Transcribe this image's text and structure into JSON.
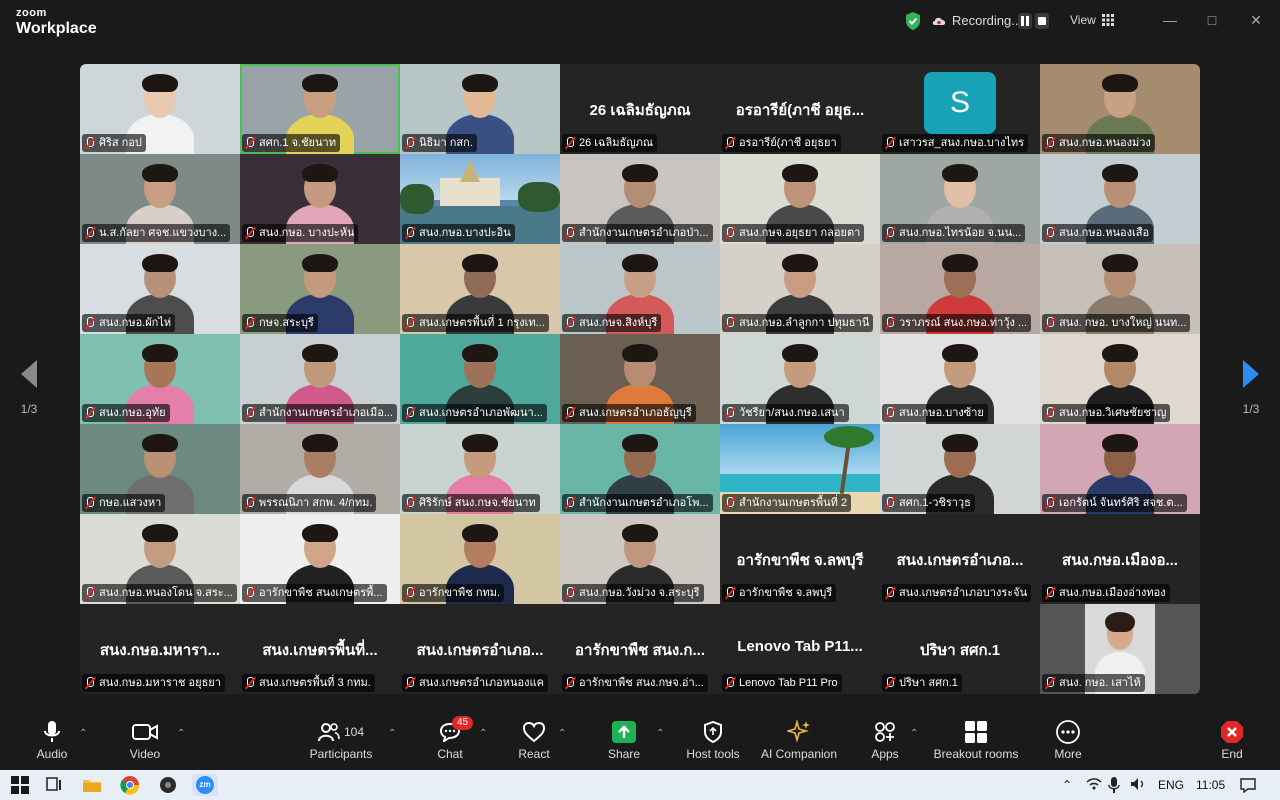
{
  "app": {
    "brand_small": "zoom",
    "brand_large": "Workplace"
  },
  "titlebar": {
    "recording_label": "Recording...",
    "view_label": "View"
  },
  "pagination": {
    "left": "1/3",
    "right": "1/3"
  },
  "tiles": [
    {
      "name": "ศิริส กอป",
      "bg": "#cfd6da",
      "skin": "#e9c9b0",
      "shirt": "#f2f2f2"
    },
    {
      "name": "สศก.1 จ.ชัยนาท",
      "bg": "#9aa3a8",
      "skin": "#c79e7f",
      "shirt": "#e2d25a",
      "active": true
    },
    {
      "name": "นิธิมา กสก.",
      "bg": "#b9c6c6",
      "skin": "#e3b895",
      "shirt": "#3a4f84"
    },
    {
      "name": "26 เฉลิมธัญภณ",
      "big": "26 เฉลิมธัญภณ"
    },
    {
      "name": "อรอารีย์(ภาชี อยุธยา",
      "big": "อรอารีย์(ภาชี อยุธ..."
    },
    {
      "name": "เสาวรส_สนง.กษอ.บางไทร",
      "avatar": "S"
    },
    {
      "name": "สนง.กษอ.หนองม่วง",
      "bg": "#a68c6f",
      "skin": "#c7a184",
      "shirt": "#6b7a55"
    },
    {
      "name": "น.ส.กัลยา ศจช.แขวงบาง...",
      "bg": "#7e8a88",
      "skin": "#c89e82",
      "shirt": "#d8d0c8"
    },
    {
      "name": "สนง.กษอ. บางปะหัน",
      "bg": "#3a2f36",
      "skin": "#c59a80",
      "shirt": "#e0a6b8"
    },
    {
      "name": "สนง.กษอ.บางปะอิน",
      "bg": "#5a86a8",
      "scene": "palace"
    },
    {
      "name": "สำนักงานเกษตรอำเภอป่า...",
      "bg": "#c9c4bf",
      "skin": "#b38d74",
      "shirt": "#5a5a5a"
    },
    {
      "name": "สนง.กษจ.อยุธยา กลอยตา",
      "bg": "#d9dcd2",
      "skin": "#bd9478",
      "shirt": "#4a4a4a"
    },
    {
      "name": "สนง.กษอ.ไทรน้อย จ.นน...",
      "bg": "#9fa7a2",
      "skin": "#e0bfa6",
      "shirt": "#b0b0b0"
    },
    {
      "name": "สนง.กษอ.หนองเสือ",
      "bg": "#c3ced3",
      "skin": "#b89074",
      "shirt": "#5a6b7a"
    },
    {
      "name": "สนง.กษอ.ผักไห่",
      "bg": "#d7dde0",
      "skin": "#b7907a",
      "shirt": "#4d4d4d"
    },
    {
      "name": "กษจ.สระบุรี",
      "bg": "#8a9a7e",
      "skin": "#c39a7c",
      "shirt": "#2c3c6a"
    },
    {
      "name": "สนง.เกษตรพื้นที่ 1 กรุงเท...",
      "bg": "#d8c8a9",
      "skin": "#8f6a55",
      "shirt": "#3a3a3a"
    },
    {
      "name": "สนง.กษจ.สิงห์บุรี",
      "bg": "#bcc7c9",
      "skin": "#c79f85",
      "shirt": "#d45a5a"
    },
    {
      "name": "สนง.กษอ.ลำลูกกา ปทุมธานี",
      "bg": "#d5d1c8",
      "skin": "#c89d82",
      "shirt": "#3c3c3c"
    },
    {
      "name": "วราภรณ์ สนง.กษอ.ท่าวุ้ง ...",
      "bg": "#b9a7a1",
      "skin": "#9c6f57",
      "shirt": "#cf3a3a"
    },
    {
      "name": "สนง. กษอ. บางใหญ่ นนท...",
      "bg": "#c7c0b8",
      "skin": "#b68e74",
      "shirt": "#8a7b6c"
    },
    {
      "name": "สนง.กษอ.อุทัย",
      "bg": "#7fbfb0",
      "skin": "#a57658",
      "shirt": "#e37fa9"
    },
    {
      "name": "สำนักงานเกษตรอำเภอเมือ...",
      "bg": "#c7cfd0",
      "skin": "#c0987c",
      "shirt": "#d05a8a"
    },
    {
      "name": "สนง.เกษตรอำเภอพัฒนา...",
      "bg": "#4ea89c",
      "skin": "#9d7258",
      "shirt": "#2b3d3d"
    },
    {
      "name": "สนง.เกษตรอำเภอธัญบุรี",
      "bg": "#6b5f52",
      "skin": "#b78c72",
      "shirt": "#e07a3a"
    },
    {
      "name": "วัชรียา/สนง.กษอ.เสนา",
      "bg": "#cfd7d5",
      "skin": "#c59b7f",
      "shirt": "#2d2d2d"
    },
    {
      "name": "สนง.กษอ.บางซ้าย",
      "bg": "#e1e1e1",
      "skin": "#c49a7f",
      "shirt": "#303030"
    },
    {
      "name": "สนง.กษอ.วิเศษชัยชาญ",
      "bg": "#ded8cf",
      "skin": "#b18868",
      "shirt": "#1f1f1f"
    },
    {
      "name": "กษอ.แสวงหา",
      "bg": "#6c8a7f",
      "skin": "#bb9174",
      "shirt": "#6f6f6f"
    },
    {
      "name": "พรรณนิภา สกพ. 4/กทม.",
      "bg": "#b1aca6",
      "skin": "#a97e62",
      "shirt": "#d9d9d9"
    },
    {
      "name": "ศิริรักษ์ สนง.กษจ.ชัยนาท",
      "bg": "#c9d3d0",
      "skin": "#c69a7d",
      "shirt": "#e67ea7"
    },
    {
      "name": "สำนักงานเกษตรอำเภอโพ...",
      "bg": "#69b5a6",
      "skin": "#956a51",
      "shirt": "#2f3e47"
    },
    {
      "name": "สำนักงานเกษตรพื้นที่ 2",
      "bg": "#67b6d6",
      "scene": "beach"
    },
    {
      "name": "สศก.1-วชิราวุธ",
      "bg": "#d3d6d7",
      "skin": "#9c6d53",
      "shirt": "#2b2b2b"
    },
    {
      "name": "เอกรัตน์ จันทร์ศิริ สจช.ต...",
      "bg": "#d3a6b6",
      "skin": "#8d6148",
      "shirt": "#2a3a6a"
    },
    {
      "name": "สนง.กษอ.หนองโดน จ.สระ...",
      "bg": "#dcdcd6",
      "skin": "#c49c80",
      "shirt": "#5a5a5a"
    },
    {
      "name": "อารักขาพืช สนงเกษตรพื้...",
      "bg": "#efefef",
      "skin": "#d1a587",
      "shirt": "#222222"
    },
    {
      "name": "อารักขาพืช กทม.",
      "bg": "#d3c6a3",
      "skin": "#b27e5e",
      "shirt": "#1d2a4e"
    },
    {
      "name": "สนง.กษอ.วังม่วง จ.สระบุรี",
      "bg": "#cdc8c1",
      "skin": "#c0977c",
      "shirt": "#2b2b2b"
    },
    {
      "name": "อารักขาพืช จ.ลพบุรี",
      "big": "อารักขาพืช จ.ลพบุรี"
    },
    {
      "name": "สนง.เกษตรอำเภอบางระจัน",
      "big": "สนง.เกษตรอำเภอ..."
    },
    {
      "name": "สนง.กษอ.เมืองอ่างทอง",
      "big": "สนง.กษอ.เมืองอ..."
    },
    {
      "name": "สนง.กษอ.มหาราช อยุธยา",
      "big": "สนง.กษอ.มหารา..."
    },
    {
      "name": "สนง.เกษตรพื้นที่ 3 กทม.",
      "big": "สนง.เกษตรพื้นที่..."
    },
    {
      "name": "สนง.เกษตรอำเภอหนองแค",
      "big": "สนง.เกษตรอำเภอ..."
    },
    {
      "name": "อารักขาพืช สนง.กษจ.อ่า...",
      "big": "อารักขาพืช สนง.ก..."
    },
    {
      "name": "Lenovo Tab P11 Pro",
      "big": "Lenovo Tab P11..."
    },
    {
      "name": "ปริษา สศก.1",
      "big": "ปริษา สศก.1"
    },
    {
      "name": "สนง. กษอ. เสาไห้",
      "thumb": true
    }
  ],
  "toolbar": {
    "audio": "Audio",
    "video": "Video",
    "participants": "Participants",
    "participants_count": "104",
    "chat": "Chat",
    "chat_badge": "45",
    "react": "React",
    "share": "Share",
    "host_tools": "Host tools",
    "ai_companion": "AI Companion",
    "apps": "Apps",
    "breakout": "Breakout rooms",
    "more": "More",
    "end": "End"
  },
  "taskbar": {
    "lang": "ENG",
    "time": "11:05",
    "zoom_icon_text": "zm"
  },
  "colors": {
    "accent_green": "#47c24f",
    "mute_red": "#e02828",
    "share_green": "#1fb155",
    "end_red": "#e02828",
    "avatar_teal": "#17a2b8",
    "next_arrow_blue": "#2a8cf0"
  }
}
